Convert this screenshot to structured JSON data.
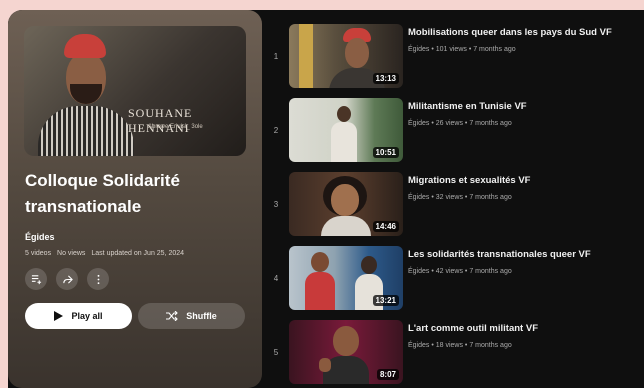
{
  "playlist": {
    "title": "Colloque Solidarité transnationale",
    "owner": "Égides",
    "stats": [
      "5 videos",
      "No views",
      "Last updated on Jun 25, 2024"
    ],
    "hero_overlay": "SOUHANE HENNANI",
    "hero_sub": "Abrowe Eriuisi_ 3ole"
  },
  "actions": {
    "save_icon": "add-to-queue-icon",
    "share_icon": "share-icon",
    "more_icon": "more-vert-icon",
    "play_all_label": "Play all",
    "shuffle_label": "Shuffle"
  },
  "videos": [
    {
      "index": "1",
      "title": "Mobilisations queer dans les pays du Sud VF",
      "meta": "Égides • 101 views • 7 months ago",
      "duration": "13:13"
    },
    {
      "index": "2",
      "title": "Militantisme en Tunisie VF",
      "meta": "Égides • 26 views • 7 months ago",
      "duration": "10:51"
    },
    {
      "index": "3",
      "title": "Migrations et sexualités VF",
      "meta": "Égides • 32 views • 7 months ago",
      "duration": "14:46"
    },
    {
      "index": "4",
      "title": "Les solidarités transnationales queer VF",
      "meta": "Égides • 42 views • 7 months ago",
      "duration": "13:21"
    },
    {
      "index": "5",
      "title": "L'art comme outil militant VF",
      "meta": "Égides • 18 views • 7 months ago",
      "duration": "8:07"
    }
  ],
  "colors": {
    "background": "#0f0f0f",
    "panel": "#544a40",
    "page": "#f5d5d0"
  }
}
